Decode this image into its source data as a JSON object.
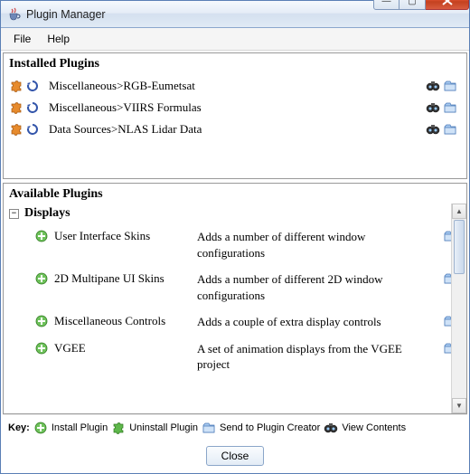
{
  "window": {
    "title": "Plugin Manager"
  },
  "menu": {
    "file": "File",
    "help": "Help"
  },
  "installed": {
    "heading": "Installed Plugins",
    "items": [
      {
        "label": "Miscellaneous>RGB-Eumetsat"
      },
      {
        "label": "Miscellaneous>VIIRS Formulas"
      },
      {
        "label": "Data Sources>NLAS Lidar Data"
      }
    ]
  },
  "available": {
    "heading": "Available Plugins",
    "category": "Displays",
    "plugins": [
      {
        "name": "User Interface Skins",
        "desc": "Adds a number of different window configurations"
      },
      {
        "name": "2D Multipane UI Skins",
        "desc": "Adds a number of different 2D window configurations"
      },
      {
        "name": "Miscellaneous Controls",
        "desc": "Adds a couple of extra display controls"
      },
      {
        "name": "VGEE",
        "desc": "A set of animation displays from the VGEE project"
      }
    ]
  },
  "key": {
    "label": "Key:",
    "install": "Install Plugin",
    "uninstall": "Uninstall Plugin",
    "send": "Send to Plugin Creator",
    "view": "View Contents"
  },
  "footer": {
    "close": "Close"
  }
}
